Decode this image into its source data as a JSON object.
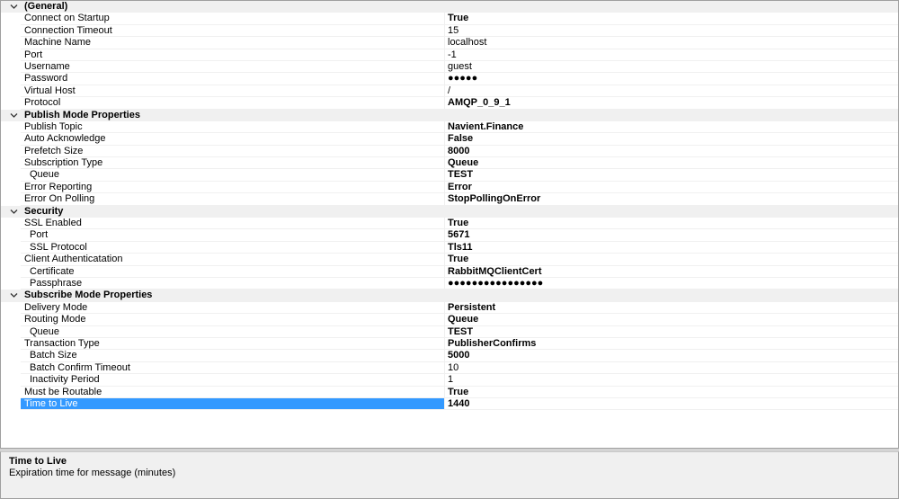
{
  "categories": [
    {
      "label": "(General)",
      "rows": [
        {
          "name": "Connect on Startup",
          "value": "True",
          "bold": true
        },
        {
          "name": "Connection Timeout",
          "value": "15",
          "bold": false
        },
        {
          "name": "Machine Name",
          "value": "localhost",
          "bold": false
        },
        {
          "name": "Port",
          "value": "-1",
          "bold": false
        },
        {
          "name": "Username",
          "value": "guest",
          "bold": false
        },
        {
          "name": "Password",
          "value": "●●●●●",
          "bold": false
        },
        {
          "name": "Virtual Host",
          "value": "/",
          "bold": false
        },
        {
          "name": "Protocol",
          "value": "AMQP_0_9_1",
          "bold": true
        }
      ]
    },
    {
      "label": "Publish Mode Properties",
      "rows": [
        {
          "name": "Publish Topic",
          "value": "Navient.Finance",
          "bold": true
        },
        {
          "name": "Auto Acknowledge",
          "value": "False",
          "bold": true
        },
        {
          "name": "Prefetch Size",
          "value": "8000",
          "bold": true
        },
        {
          "name": "Subscription Type",
          "value": "Queue",
          "bold": true
        },
        {
          "name": "Queue",
          "value": "TEST",
          "bold": true,
          "indent": true
        },
        {
          "name": "Error Reporting",
          "value": "Error",
          "bold": true
        },
        {
          "name": "Error On Polling",
          "value": "StopPollingOnError",
          "bold": true
        }
      ]
    },
    {
      "label": "Security",
      "rows": [
        {
          "name": "SSL Enabled",
          "value": "True",
          "bold": true
        },
        {
          "name": "Port",
          "value": "5671",
          "bold": true,
          "indent": true
        },
        {
          "name": "SSL Protocol",
          "value": "Tls11",
          "bold": true,
          "indent": true
        },
        {
          "name": "Client Authenticatation",
          "value": "True",
          "bold": true
        },
        {
          "name": "Certificate",
          "value": "RabbitMQClientCert",
          "bold": true,
          "indent": true
        },
        {
          "name": "Passphrase",
          "value": "●●●●●●●●●●●●●●●●",
          "bold": true,
          "indent": true
        }
      ]
    },
    {
      "label": "Subscribe Mode Properties",
      "rows": [
        {
          "name": "Delivery Mode",
          "value": "Persistent",
          "bold": true
        },
        {
          "name": "Routing Mode",
          "value": "Queue",
          "bold": true
        },
        {
          "name": "Queue",
          "value": "TEST",
          "bold": true,
          "indent": true
        },
        {
          "name": "Transaction Type",
          "value": "PublisherConfirms",
          "bold": true
        },
        {
          "name": "Batch Size",
          "value": "5000",
          "bold": true,
          "indent": true
        },
        {
          "name": "Batch Confirm Timeout",
          "value": "10",
          "bold": false,
          "indent": true
        },
        {
          "name": "Inactivity Period",
          "value": "1",
          "bold": false,
          "indent": true
        },
        {
          "name": "Must be Routable",
          "value": "True",
          "bold": true
        },
        {
          "name": "Time to Live",
          "value": "1440",
          "bold": true,
          "selected": true
        }
      ]
    }
  ],
  "help": {
    "title": "Time to Live",
    "description": "Expiration time for message (minutes)"
  },
  "colors": {
    "selection": "#3399ff",
    "category_bg": "#f0f0f0"
  },
  "icons": {
    "expander": "chevron-down-icon"
  }
}
